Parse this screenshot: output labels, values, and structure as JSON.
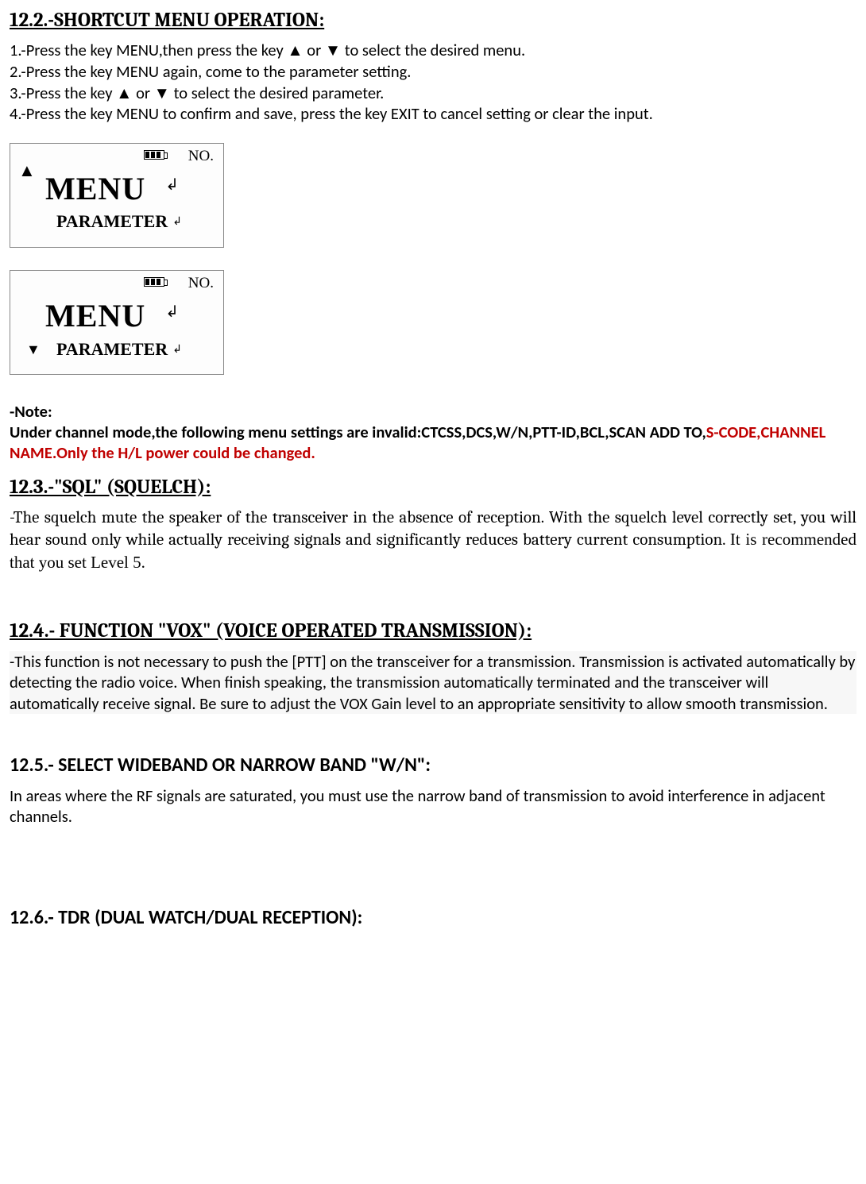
{
  "s122": {
    "heading": "12.2.-SHORTCUT MENU OPERATION:",
    "step1": "1.-Press the key MENU,then press the key ▲ or ▼ to select the desired menu.",
    "step2": "2.-Press the key MENU again, come to the parameter setting.",
    "step3": "3.-Press the key   ▲   or   ▼   to select the desired parameter.",
    "step4": "4.-Press the key MENU to confirm and save, press the key EXIT to cancel setting or clear the input."
  },
  "lcd": {
    "no_label": "NO.",
    "menu_label": "MENU",
    "param_label": "PARAMETER"
  },
  "note": {
    "label": "-Note:",
    "line_black": "Under channel mode,the following menu settings are invalid:CTCSS,DCS,W/N,PTT-ID,BCL,SCAN ADD TO,",
    "line_red": "S-CODE,CHANNEL NAME.Only the H/L power could be changed."
  },
  "s123": {
    "heading": "12.3.-\"SQL\" (SQUELCH):",
    "body_a": "-The squelch mute the speaker of the transceiver in the absence of reception. With the squelch level correctly set, you will hear sound only while actually receiving signals and significantly reduces battery current consumption. ",
    "body_b": "It is recommended that you set Level 5."
  },
  "s124": {
    "heading": "12.4.- FUNCTION \"VOX\" (VOICE OPERATED TRANSMISSION):",
    "body": "-This function is not necessary to push the [PTT] on the transceiver for a transmission. Transmission is activated automatically by detecting the radio voice. When finish speaking, the transmission automatically terminated and the transceiver will automatically receive signal. Be sure to adjust the VOX Gain level to an appropriate sensitivity to allow smooth transmission."
  },
  "s125": {
    "heading": "12.5.- SELECT WIDEBAND OR NARROW BAND \"W/N\":",
    "body": "In areas where the RF signals are saturated, you must use the narrow band of transmission to avoid interference in adjacent channels."
  },
  "s126": {
    "heading": "12.6.- TDR (DUAL WATCH/DUAL RECEPTION):"
  }
}
